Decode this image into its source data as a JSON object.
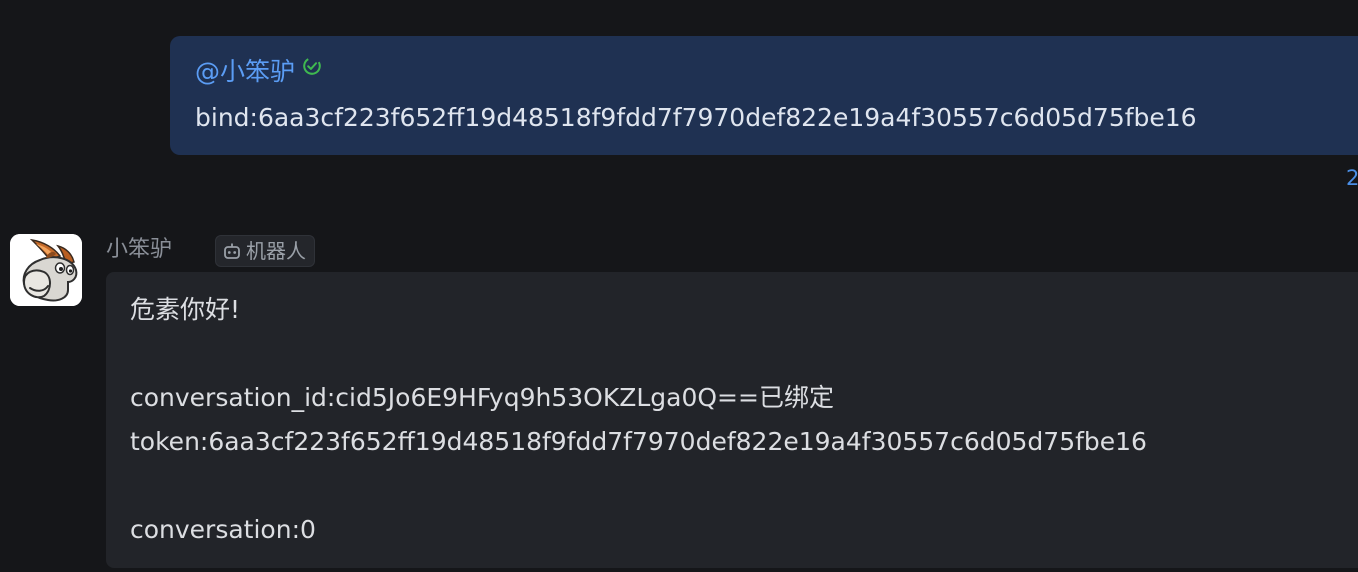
{
  "outgoing": {
    "mention": "@小笨驴",
    "text": "bind:6aa3cf223f652ff19d48518f9fdd7f7970def822e19a4f30557c6d05d75fbe16",
    "time_partial": "2"
  },
  "incoming": {
    "sender": "小笨驴",
    "badge": "机器人",
    "lines": [
      "危素你好!",
      "conversation_id:cid5Jo6E9HFyq9h53OKZLga0Q==已绑定",
      "token:6aa3cf223f652ff19d48518f9fdd7f7970def822e19a4f30557c6d05d75fbe16",
      "conversation:0"
    ]
  },
  "icons": {
    "verified": "check-circle-icon",
    "bot": "robot-icon",
    "avatar": "donkey-avatar"
  },
  "colors": {
    "background": "#151619",
    "outgoing_bubble": "#1f3152",
    "incoming_bubble": "#222429",
    "mention": "#5b9df5",
    "verified": "#3fb950"
  }
}
